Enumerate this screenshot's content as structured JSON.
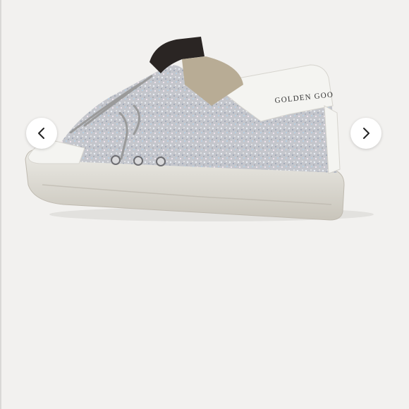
{
  "carousel": {
    "prev_icon": "chevron-left-icon",
    "next_icon": "chevron-right-icon"
  },
  "product": {
    "image_alt": "sneaker-image",
    "brand_print": "GOLDEN GOO",
    "colors": {
      "background": "#f2f1ef",
      "glitter": "#c7c9cf",
      "leather": "#f4f4f1",
      "sole": "#dedbd2",
      "tab": "#2a2523"
    }
  }
}
